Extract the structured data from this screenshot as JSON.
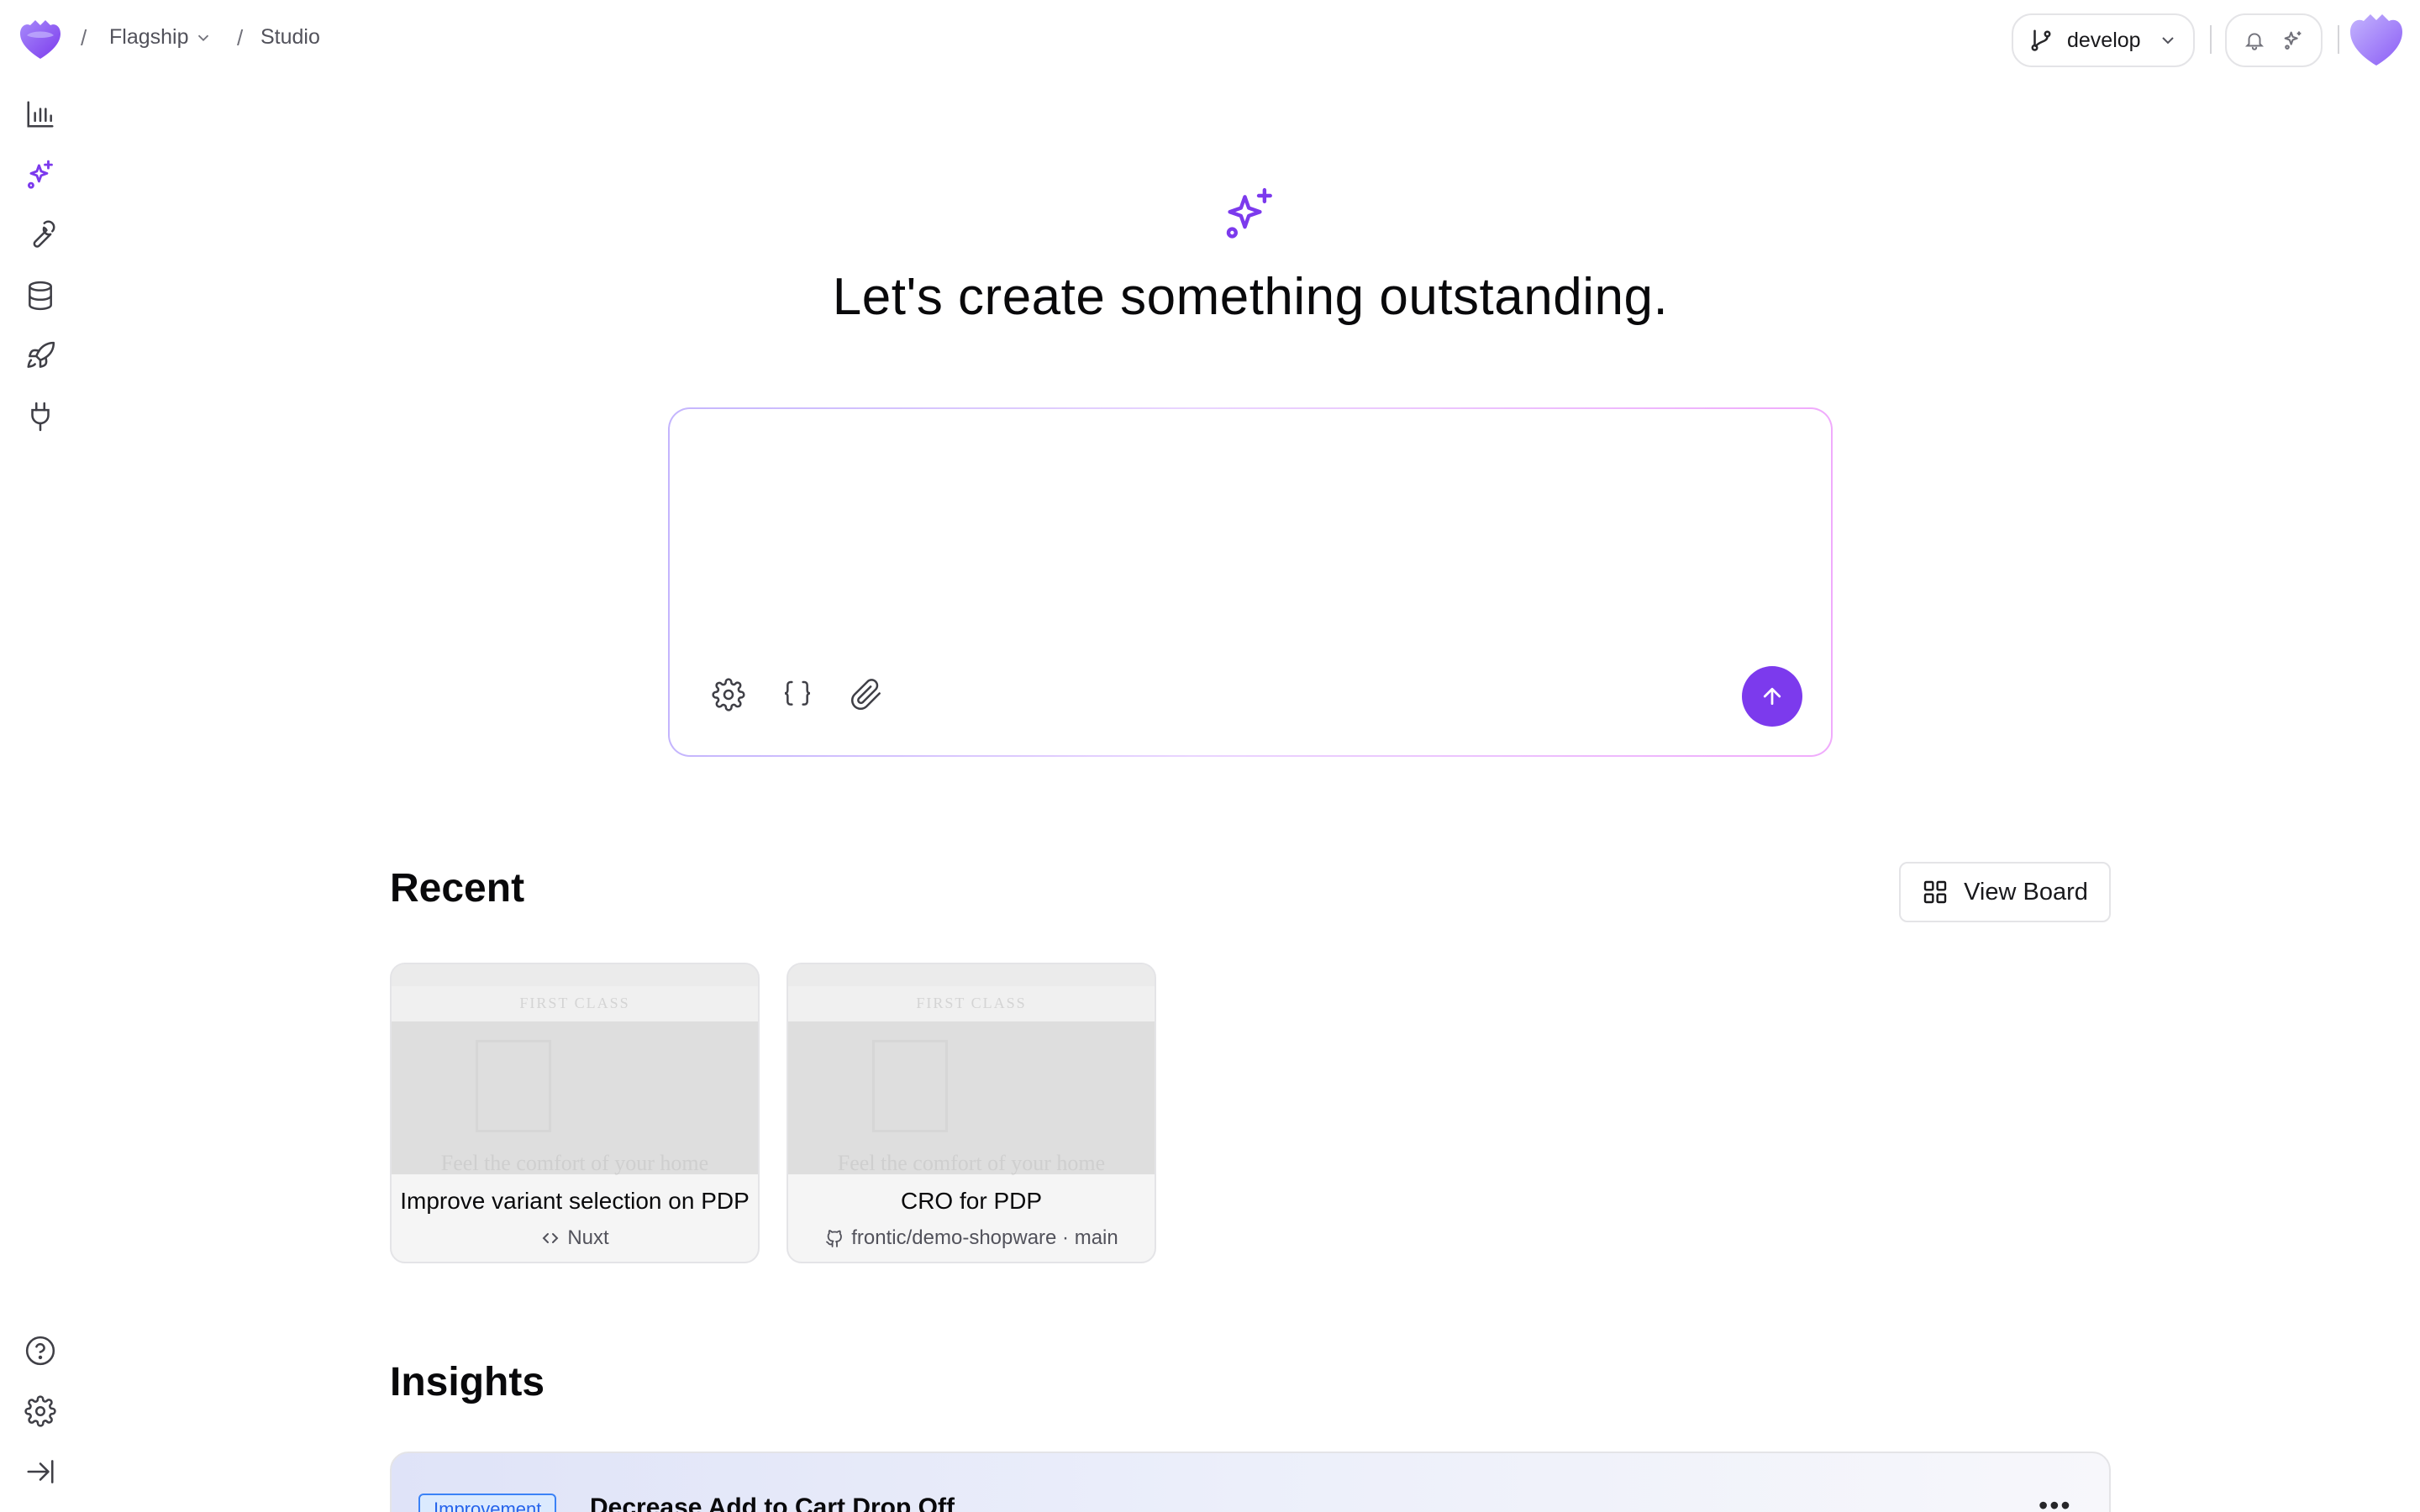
{
  "header": {
    "breadcrumb": {
      "project": "Flagship",
      "page": "Studio",
      "separator": "/"
    },
    "branch": "develop"
  },
  "hero": {
    "title": "Let's create something outstanding."
  },
  "prompt": {
    "value": "",
    "placeholder": ""
  },
  "recent": {
    "title": "Recent",
    "view_board_label": "View Board",
    "cards": [
      {
        "title": "Improve variant selection on PDP",
        "subtitle": "Nuxt",
        "subtitle_icon": "code-icon",
        "preview_brand": "FIRST CLASS",
        "preview_tagline": "Feel the comfort of your home"
      },
      {
        "title": "CRO for PDP",
        "subtitle": "frontic/demo-shopware · main",
        "subtitle_icon": "github-icon",
        "preview_brand": "FIRST CLASS",
        "preview_tagline": "Feel the comfort of your home"
      }
    ]
  },
  "insights": {
    "title": "Insights",
    "items": [
      {
        "badge": "Improvement",
        "title": "Decrease Add to Cart Drop Off"
      }
    ]
  },
  "colors": {
    "accent": "#7c3aed",
    "badge_blue": "#2563eb"
  }
}
